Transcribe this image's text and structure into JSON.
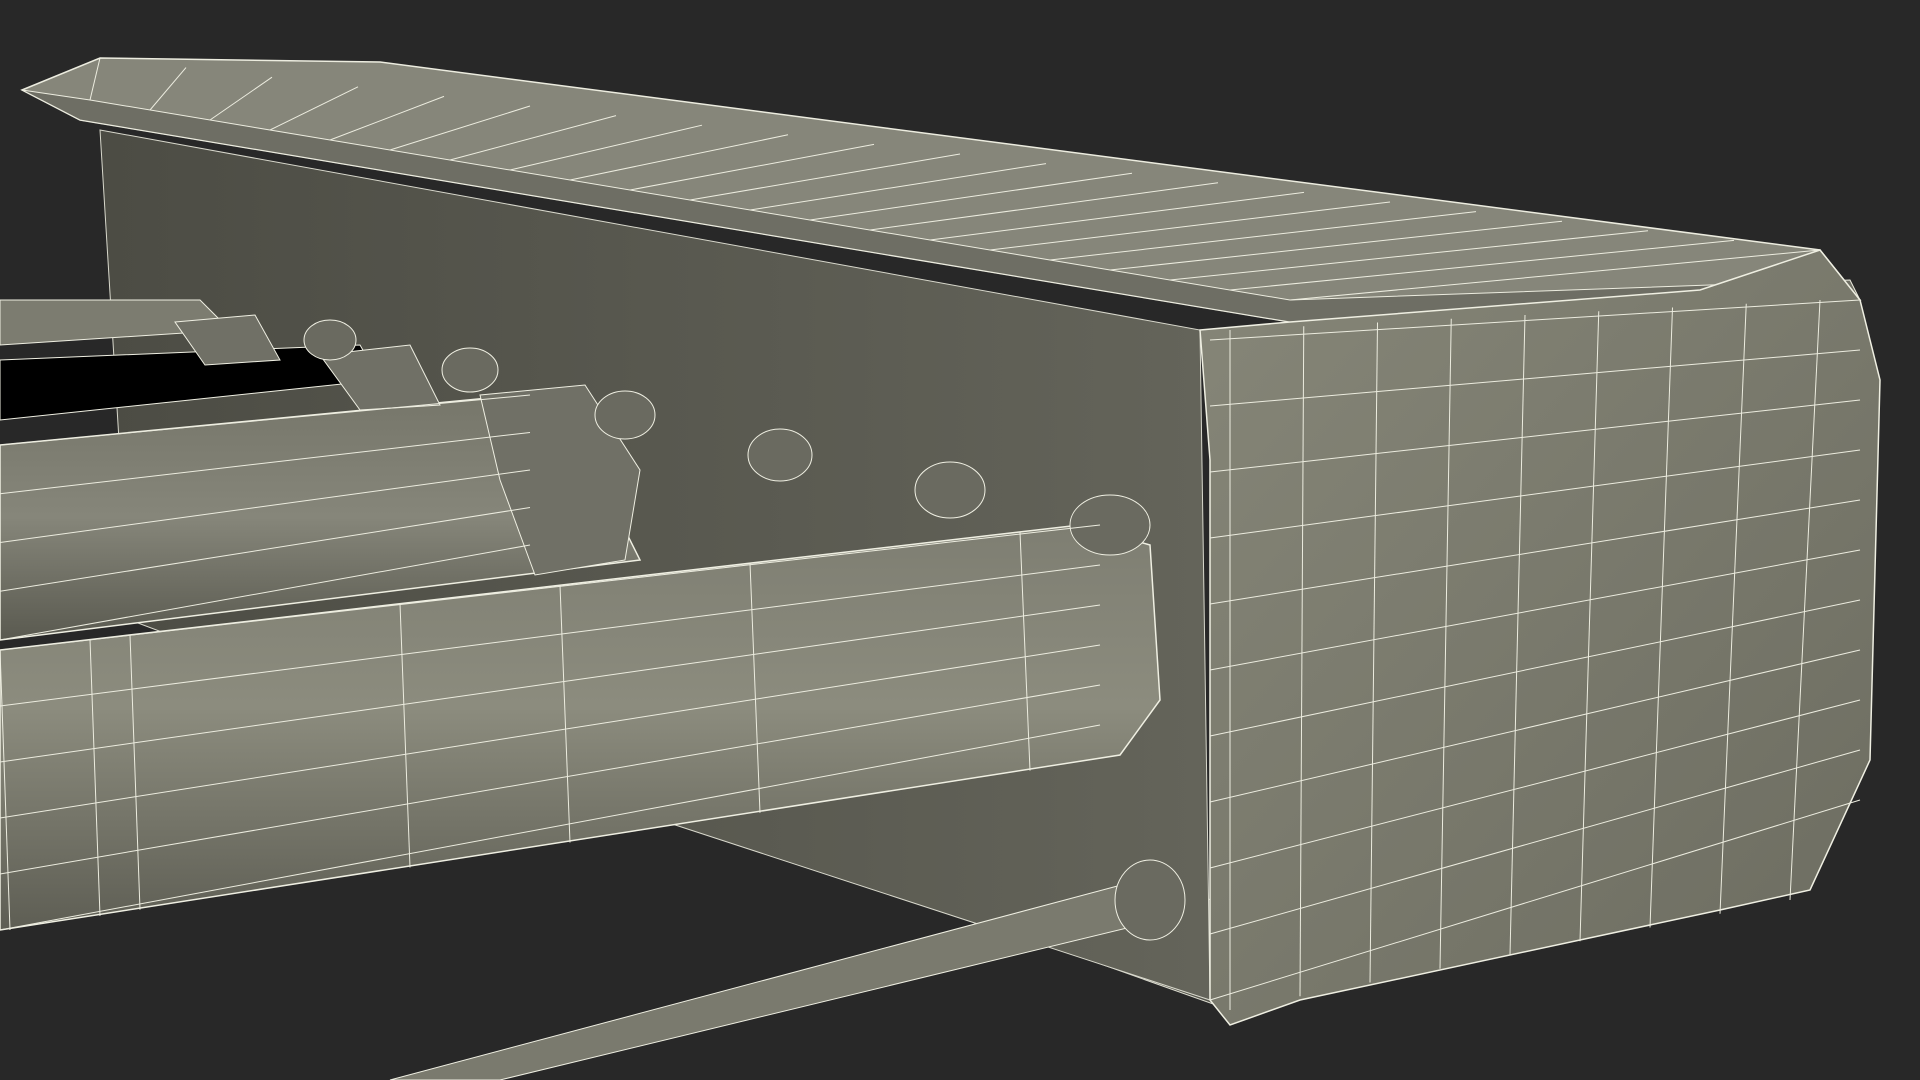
{
  "scene": {
    "subject": "wireframe-3d-render",
    "colors": {
      "background": "#282828",
      "surface_light": "#8a8a7c",
      "surface_mid": "#76766a",
      "surface_dark": "#5a5a50",
      "surface_shadow": "#3e3e38",
      "wire": "#e8e8dc"
    }
  }
}
